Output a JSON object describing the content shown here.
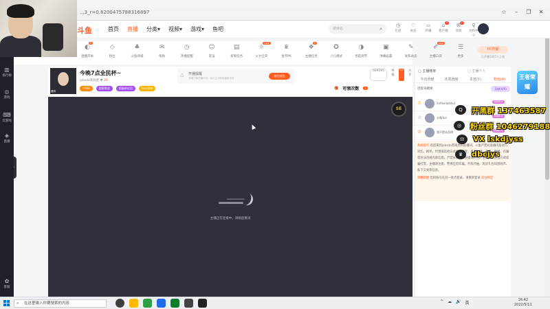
{
  "browser": {
    "url": "...3_r=0.8200475788316897",
    "controls": [
      "☆",
      "–",
      "❐",
      "✕"
    ]
  },
  "nav": {
    "logo": "斗鱼",
    "links": [
      {
        "label": "首页",
        "active": false
      },
      {
        "label": "直播",
        "active": true
      },
      {
        "label": "分类▾",
        "active": false
      },
      {
        "label": "视频▾",
        "active": false
      },
      {
        "label": "游戏▾",
        "active": false
      },
      {
        "label": "鱼吧",
        "active": false
      }
    ],
    "search_placeholder": "搜目名",
    "top_icons": [
      {
        "icon": "◷",
        "label": "历史"
      },
      {
        "icon": "♡",
        "label": "关注"
      },
      {
        "icon": "▭",
        "label": "开播"
      },
      {
        "icon": "⌂",
        "label": "客户端",
        "badge": "5"
      },
      {
        "icon": "✉",
        "label": "消息",
        "badge": "11"
      },
      {
        "icon": "♀",
        "label": "创作中心"
      }
    ]
  },
  "sidebar": [
    {
      "icon": "▥",
      "label": "排行榜"
    },
    {
      "icon": "◎",
      "label": "游戏"
    },
    {
      "icon": "⌨",
      "label": "云游戏"
    },
    {
      "icon": "◈",
      "label": "直播"
    },
    {
      "icon": "✿",
      "label": "客服"
    }
  ],
  "features": [
    {
      "icon": "◐",
      "label": "直播开关",
      "tag": "2"
    },
    {
      "icon": "◇",
      "label": "粉丝"
    },
    {
      "icon": "♣",
      "label": "斗鱼商城"
    },
    {
      "icon": "✉",
      "label": "帮助"
    },
    {
      "icon": "◷",
      "label": "开播提醒"
    },
    {
      "icon": "☺",
      "label": "友谊"
    },
    {
      "icon": "▤",
      "label": "新版任务"
    },
    {
      "icon": "☼",
      "label": "火力全开",
      "tag": "new"
    },
    {
      "icon": "♛",
      "label": "金币PK"
    },
    {
      "icon": "❖",
      "label": "主播任务",
      "tag": "5"
    },
    {
      "icon": "✪",
      "label": "少儿模式"
    },
    {
      "icon": "◑",
      "label": "亮度调节"
    },
    {
      "icon": "▣",
      "label": "弹幕设置"
    },
    {
      "icon": "✎",
      "label": "发布动态"
    },
    {
      "icon": "✐",
      "label": "主播口袋",
      "tag": "new"
    },
    {
      "icon": "☰",
      "label": "更多"
    }
  ],
  "pc_button": {
    "label": "PC开播",
    "sub": "已开播1007人上线"
  },
  "room": {
    "title": "今晚7点全民杯~",
    "anchor_tag": "猪肉",
    "sub": "jaksda黑闹虎",
    "hot": "29",
    "badges": [
      {
        "label": "V闻网",
        "color": "#ff8a00"
      },
      {
        "label": "超星挑战",
        "color": "#a24df2"
      },
      {
        "label": "超级粉丝团",
        "color": "#a24df2"
      },
      {
        "label": "fans荣誉",
        "color": "#ffb300"
      }
    ],
    "tip_title": "开播提醒",
    "tip_text": "准确了解开播时间，每天主动获取最新消息",
    "tip_button": "前往前往",
    "right_info": [
      "689395",
      "举报",
      "▭",
      "分享",
      "客户端"
    ],
    "act_label": "可领次数",
    "act_count": "1"
  },
  "player": {
    "logo": "SE",
    "message": "主播正在连接中，请稍后重试"
  },
  "chat": {
    "header": "▢ 主播榜单",
    "header_right": "▢ 主播个人",
    "tabs": [
      {
        "label": "今日贡献",
        "on": false
      },
      {
        "label": "本周贡献",
        "on": false
      },
      {
        "label": "贵宾(5)",
        "on": false
      },
      {
        "label": "粉丝(4)",
        "on": true
      }
    ],
    "rank_title": "连续贡献榜",
    "rank_btn": "贡献(4/6)",
    "ranks": [
      {
        "crown": "♔",
        "name": "XvPandabite1",
        "tag": "超级粉丝"
      },
      {
        "crown": "♔",
        "name": "头像Yun",
        "tag": "超级粉丝"
      },
      {
        "crown": "♔",
        "name": "我不是泳而律",
        "tag": "超级粉丝"
      }
    ],
    "messages": [
      {
        "prefix": "系统提示:",
        "text": "欢迎来到jaksda黑闹虎的直播间。斗鱼严禁对直播内容进行对比，刷单，代理或其他方式虚假宣传，暴力血腥，吸毒，赌博，诈骗等违法违规内容信息。严禁未成年人直播或打赏。主播以不正当方式或骗打赏，主播请注意，警惕任何诈骗。代练代抽、购买礼包码游戏币、私下交易等信息。"
      },
      {
        "prefix": "温馨提醒:",
        "text": "您的账号在另一处点登录，请重新登录 ",
        "link": "前往绑定"
      }
    ]
  },
  "overlay": [
    {
      "icon": "Q",
      "text": "开黑群 137463587"
    },
    {
      "icon": "◎",
      "text": "粉丝群 1046279188"
    },
    {
      "icon": "✉",
      "text": "VX lskdjyss"
    },
    {
      "icon": "♛",
      "text": "dbcjys"
    }
  ],
  "promo": {
    "text": "王者荣耀"
  },
  "taskbar": {
    "search_placeholder": "在这里输入你要搜索的内容",
    "apps": [
      "#3d3d3d",
      "#ffb900",
      "#2ea043",
      "#1f6feb",
      "#0e7a2b",
      "#444444",
      "#222222"
    ],
    "tray": [
      "^",
      "☁",
      "🔊",
      "英"
    ],
    "time": "16:42",
    "date": "2022/5/11"
  }
}
